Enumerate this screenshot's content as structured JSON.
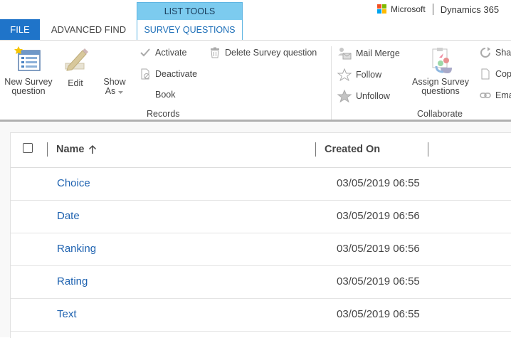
{
  "brand": {
    "company": "Microsoft",
    "product": "Dynamics 365",
    "logo_colors": [
      "#f25022",
      "#7fba00",
      "#00a4ef",
      "#ffb900"
    ]
  },
  "tabs": {
    "file": "FILE",
    "advanced_find": "ADVANCED FIND",
    "context_group": "LIST TOOLS",
    "survey_questions": "SURVEY QUESTIONS"
  },
  "ribbon": {
    "new_label_1": "New Survey",
    "new_label_2": "question",
    "edit": "Edit",
    "show_as_1": "Show",
    "show_as_2": "As",
    "activate": "Activate",
    "deactivate": "Deactivate",
    "book": "Book",
    "delete": "Delete Survey question",
    "records_group": "Records",
    "mail_merge": "Mail Merge",
    "follow": "Follow",
    "unfollow": "Unfollow",
    "assign_1": "Assign Survey",
    "assign_2": "questions",
    "collaborate_group": "Collaborate",
    "share": "Sha",
    "copy": "Cop",
    "email": "Ema"
  },
  "grid": {
    "columns": {
      "name": "Name",
      "created_on": "Created On"
    },
    "sort_icon": "arrow-up-icon",
    "rows": [
      {
        "name": "Choice",
        "created_on": "03/05/2019 06:55"
      },
      {
        "name": "Date",
        "created_on": "03/05/2019 06:56"
      },
      {
        "name": "Ranking",
        "created_on": "03/05/2019 06:56"
      },
      {
        "name": "Rating",
        "created_on": "03/05/2019 06:55"
      },
      {
        "name": "Text",
        "created_on": "03/05/2019 06:55"
      }
    ]
  },
  "colors": {
    "file_tab": "#1f74c9",
    "context_header": "#7ccbef",
    "link": "#1e62b0"
  }
}
